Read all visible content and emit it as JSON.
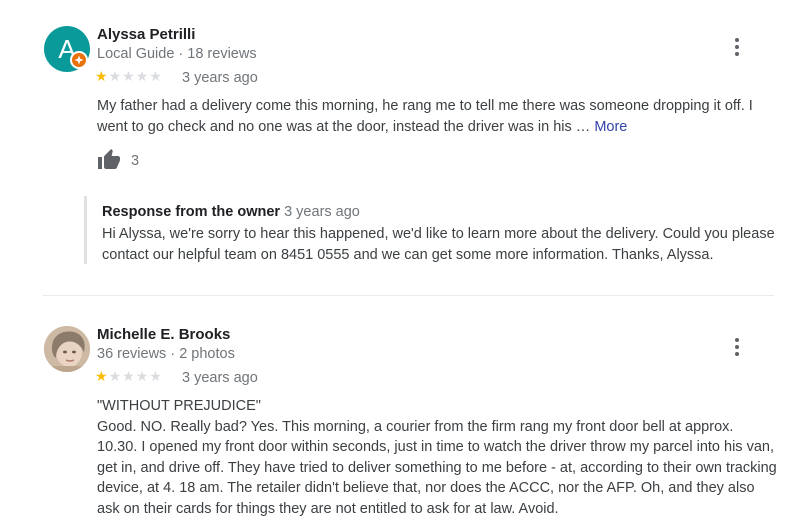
{
  "reviews": [
    {
      "author": "Alyssa Petrilli",
      "avatar_letter": "A",
      "meta": "Local Guide · 18 reviews",
      "rating": 1,
      "max_rating": 5,
      "date": "3 years ago",
      "text": "My father had a delivery come this morning, he rang me to tell me there was someone dropping it off. I went to go check and no one was at the door, instead the driver was in his …",
      "more_label": "More",
      "likes": "3",
      "owner_response": {
        "title": "Response from the owner",
        "date": "3 years ago",
        "text": "Hi Alyssa, we're sorry to hear this happened, we'd like to learn more about the delivery. Could you please contact our helpful team on 8451 0555 and we can get some more information. Thanks, Alyssa."
      }
    },
    {
      "author": "Michelle E. Brooks",
      "meta": "36 reviews · 2 photos",
      "rating": 1,
      "max_rating": 5,
      "date": "3 years ago",
      "text_heading": "\"WITHOUT PREJUDICE\"",
      "text": "Good. NO. Really bad? Yes. This morning, a courier from the firm rang my front door bell at approx. 10.30. I opened my front door within seconds, just in time to watch the driver throw my parcel into his van, get in, and drive off. They have tried to deliver something to me before - at, according to their own tracking device, at 4. 18 am. The retailer didn't believe that, nor does the ACCC, nor the AFP. Oh, and they also ask on their cards for things they are not entitled to ask for at law. Avoid."
    }
  ],
  "icons": {
    "star": "star-icon",
    "menu": "more-vert-icon",
    "like": "thumb-up-icon",
    "guide_badge": "local-guide-badge-icon"
  },
  "colors": {
    "star_filled": "#fbbc04",
    "star_empty": "#dadce0",
    "avatar_bg": "#0b9a9a",
    "guide_badge": "#e8710a",
    "link": "#3344aa"
  }
}
